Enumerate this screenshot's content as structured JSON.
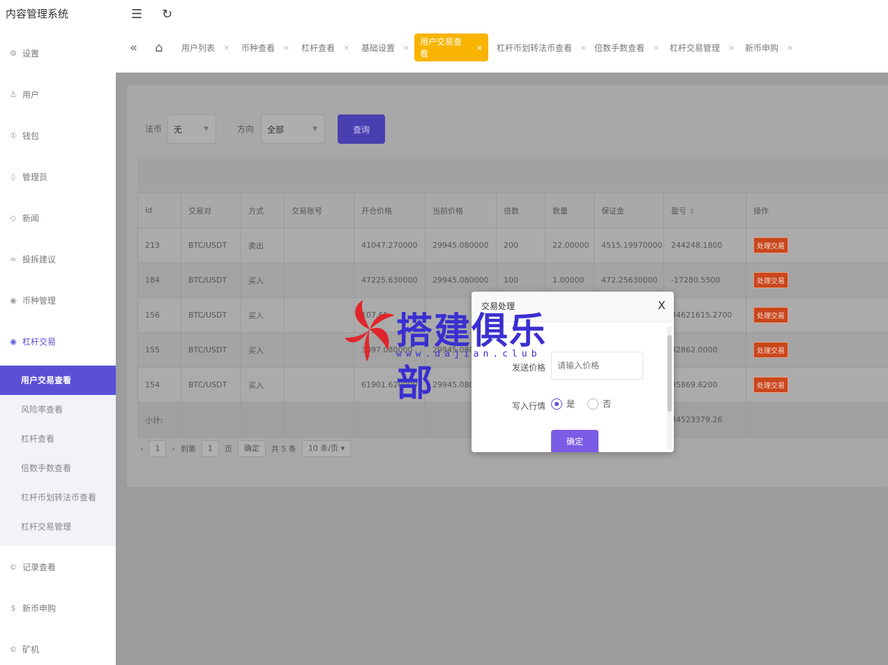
{
  "app": {
    "title": "内容管理系统"
  },
  "sidebar": {
    "items": [
      {
        "label": "设置",
        "icon": "gear-icon",
        "glyph": "⚙"
      },
      {
        "label": "用户",
        "icon": "user-icon",
        "glyph": "♙"
      },
      {
        "label": "钱包",
        "icon": "wallet-icon",
        "glyph": "①"
      },
      {
        "label": "管理员",
        "icon": "shield-icon",
        "glyph": "◊"
      },
      {
        "label": "新闻",
        "icon": "tag-icon",
        "glyph": "◇"
      },
      {
        "label": "投拆建议",
        "icon": "link-icon",
        "glyph": "∞"
      },
      {
        "label": "币种管理",
        "icon": "location-icon",
        "glyph": "◉"
      },
      {
        "label": "杠杆交易",
        "icon": "location-icon",
        "glyph": "◉"
      },
      {
        "label": "记录查看",
        "icon": "copyright-icon",
        "glyph": "©"
      },
      {
        "label": "新币申购",
        "icon": "dollar-icon",
        "glyph": "$"
      },
      {
        "label": "矿机",
        "icon": "copyright-icon",
        "glyph": "©"
      }
    ],
    "submenu": [
      {
        "label": "用户交易查看"
      },
      {
        "label": "风险率查看"
      },
      {
        "label": "杠杆查看"
      },
      {
        "label": "倍数手数查看"
      },
      {
        "label": "杠杆币划转法币查看"
      },
      {
        "label": "杠杆交易管理"
      }
    ]
  },
  "topbar": {
    "menu_icon": "☰",
    "refresh_icon": "↻"
  },
  "tabs": {
    "back_icon": "«",
    "home_icon": "⌂",
    "close_glyph": "×",
    "items": [
      {
        "label": "用户列表"
      },
      {
        "label": "币种查看"
      },
      {
        "label": "杠杆查看"
      },
      {
        "label": "基础设置"
      },
      {
        "label": "用户交易查看"
      },
      {
        "label": "杠杆币划转法币查看"
      },
      {
        "label": "倍数手数查看"
      },
      {
        "label": "杠杆交易管理"
      },
      {
        "label": "新币申购"
      }
    ]
  },
  "filters": {
    "fiat_label": "法币",
    "fiat_value": "无",
    "direction_label": "方向",
    "direction_value": "全部",
    "query_button": "查询"
  },
  "table": {
    "columns": [
      "id",
      "交易对",
      "方式",
      "交易账号",
      "开仓价格",
      "当前价格",
      "倍数",
      "数量",
      "保证金",
      "盈亏",
      "操作"
    ],
    "sort_glyph": "⇕",
    "rows": [
      {
        "id": "213",
        "pair": "BTC/USDT",
        "mode": "卖出",
        "account": "",
        "open": "41047.270000",
        "current": "29945.080000",
        "multiple": "200",
        "qty": "22.00000",
        "margin": "4515.19970000",
        "pnl": "244248.1800",
        "action": "处理交易"
      },
      {
        "id": "184",
        "pair": "BTC/USDT",
        "mode": "买入",
        "account": "",
        "open": "47225.630000",
        "current": "29945.080000",
        "multiple": "100",
        "qty": "1.00000",
        "margin": "472.25630000",
        "pnl": "-17280.5500",
        "action": "处理交易"
      },
      {
        "id": "156",
        "pair": "BTC/USDT",
        "mode": "买入",
        "account": "",
        "open": "107.65",
        "current": "",
        "multiple": "",
        "qty": "",
        "margin": "",
        "pnl": "34621615.2700",
        "action": "处理交易"
      },
      {
        "id": "155",
        "pair": "BTC/USDT",
        "mode": "买入",
        "account": "",
        "open": "3897.080000",
        "current": "29945.080",
        "multiple": "",
        "qty": "",
        "margin": "",
        "pnl": "32862.0000",
        "action": "处理交易"
      },
      {
        "id": "154",
        "pair": "BTC/USDT",
        "mode": "买入",
        "account": "",
        "open": "61901.620000",
        "current": "29945.080",
        "multiple": "",
        "qty": "",
        "margin": "",
        "pnl": "95869.6200",
        "action": "处理交易"
      }
    ],
    "total_label": "小计:",
    "total_pnl": "34523379.26"
  },
  "pager": {
    "prev": "‹",
    "current_page": "1",
    "next": "›",
    "goto_label": "到第",
    "goto_value": "1",
    "page_unit": "页",
    "confirm": "确定",
    "total": "共 5 条",
    "page_size": "10 条/页"
  },
  "modal": {
    "title": "交易处理",
    "close": "X",
    "price_label": "发送价格",
    "price_placeholder": "请输入价格",
    "write_label": "写入行情",
    "yes_label": "是",
    "no_label": "否",
    "confirm": "确定"
  },
  "watermark": {
    "text": "搭建俱乐部",
    "url": "www.dajian.club"
  },
  "colors": {
    "accent": "#5b4fd8",
    "active_tab": "#f8b400",
    "danger": "#c9461c"
  }
}
